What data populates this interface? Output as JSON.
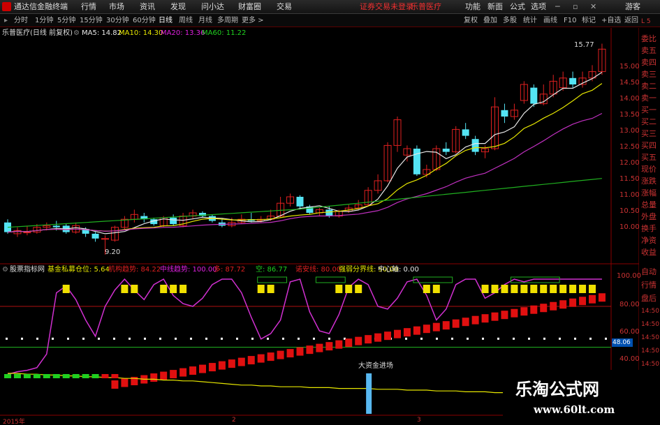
{
  "window": {
    "app_title": "通达信金融终端",
    "login_notice": "证券交易未登录",
    "stock_tag": "乐普医疗",
    "guest": "游客"
  },
  "main_menu": [
    "行情",
    "市场",
    "资讯",
    "发现",
    "问小达",
    "财富圈",
    "交易"
  ],
  "right_menu": [
    "功能",
    "新面",
    "公式",
    "选项"
  ],
  "period_tabs": [
    "分时",
    "1分钟",
    "5分钟",
    "15分钟",
    "30分钟",
    "60分钟",
    "日线",
    "周线",
    "月线",
    "多周期",
    "更多 >"
  ],
  "active_period": "日线",
  "chart_tools": [
    "复权",
    "叠加",
    "多股",
    "统计",
    "画线",
    "F10",
    "标记",
    "+自选",
    "返回"
  ],
  "stock": {
    "name": "乐普医疗",
    "title": "乐普医疗(日线 前复权)"
  },
  "ma": [
    {
      "label": "MA5: 14.82",
      "color": "#e8e8e8"
    },
    {
      "label": "MA10: 14.30",
      "color": "#e6e600"
    },
    {
      "label": "MA20: 13.36",
      "color": "#e020e0"
    },
    {
      "label": "MA60: 11.22",
      "color": "#20d020"
    }
  ],
  "price_axis": [
    "15.00",
    "14.50",
    "14.00",
    "13.50",
    "13.00",
    "12.50",
    "12.00",
    "11.50",
    "11.00",
    "10.50",
    "10.00"
  ],
  "hi_label": "15.77",
  "lo_label": "9.20",
  "right_panel": [
    "委比",
    "卖五",
    "卖四",
    "卖三",
    "卖二",
    "卖一",
    "买一",
    "买二",
    "买三",
    "买四",
    "买五",
    "现价",
    "涨跌",
    "涨幅",
    "总量",
    "外盘",
    "换手",
    "净资",
    "收益"
  ],
  "right_panel_lower": [
    "自动",
    "行情",
    "盘后",
    "14:50",
    "14:50",
    "14:50",
    "14:50",
    "14:50",
    "14:50",
    "14:50",
    "14:50"
  ],
  "corner_tag": "L 5",
  "indicator": {
    "name": "股票指标网",
    "items": [
      {
        "label": "基金私募仓位: 5.64",
        "color": "#e6e600"
      },
      {
        "label": "机构趋势: 84.22",
        "color": "#e02020"
      },
      {
        "label": "中线趋势: 100.00",
        "color": "#e020e0"
      },
      {
        "label": "多: 87.72",
        "color": "#e02020"
      },
      {
        "label": "空: 86.77",
        "color": "#20d020"
      },
      {
        "label": "诺安线: 80.00",
        "color": "#e02020"
      },
      {
        "label": "强弱分界线: 50.00",
        "color": "#e6e600"
      },
      {
        "label": "中心轴: 0.00",
        "color": "#e8e8e8"
      }
    ],
    "axis": [
      "100.00",
      "80.00",
      "60.00",
      "40.00"
    ],
    "current_value": "48.06",
    "annotation": "大资金进场"
  },
  "date_axis": [
    "2015年",
    "2",
    "3"
  ],
  "watermark": {
    "title": "乐淘公式网",
    "url": "www.60lt.com"
  },
  "colors": {
    "up": "#e02020",
    "down": "#54e4f4",
    "ma5": "#e8e8e8",
    "ma10": "#e6e600",
    "ma20": "#c030c0",
    "ma60": "#20b020"
  }
}
